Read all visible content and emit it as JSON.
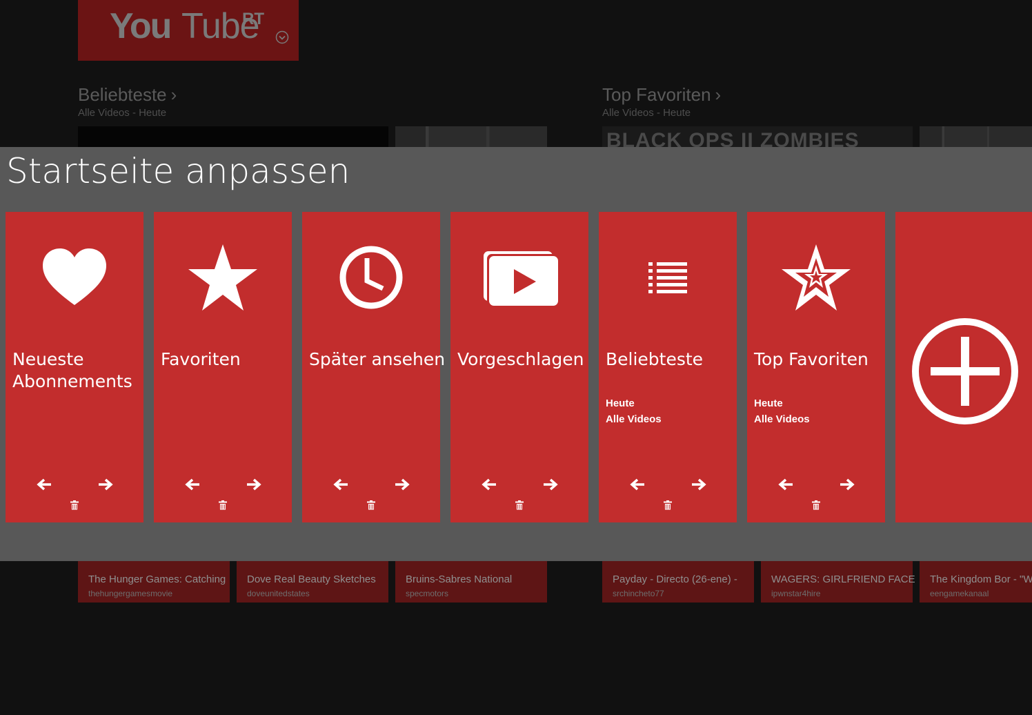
{
  "app": {
    "logo": {
      "you": "You",
      "tube": "Tube",
      "rt": "RT"
    }
  },
  "background": {
    "sections": [
      {
        "title": "Beliebteste",
        "subtitle": "Alle Videos - Heute"
      },
      {
        "title": "Top Favoriten",
        "subtitle": "Alle Videos - Heute"
      }
    ],
    "thumbnail_text": "BLACK OPS II ZOMBIES",
    "videos": [
      {
        "title": "The Hunger Games: Catching",
        "author": "thehungergamesmovie"
      },
      {
        "title": "Dove Real Beauty Sketches",
        "author": "doveunitedstates"
      },
      {
        "title": "Bruins-Sabres National",
        "author": "specmotors"
      },
      {
        "title": "Payday - Directo (26-ene) -",
        "author": "srchincheto77"
      },
      {
        "title": "WAGERS: GIRLFRIEND FACE",
        "author": "ipwnstar4hire"
      },
      {
        "title": "The Kingdom Bor - \"W",
        "author": "eengamekanaal"
      }
    ]
  },
  "overlay": {
    "title": "Startseite anpassen",
    "tiles": [
      {
        "label": "Neueste\nAbonnements",
        "icon": "heart-icon",
        "meta1": "",
        "meta2": ""
      },
      {
        "label": "Favoriten",
        "icon": "star-icon",
        "meta1": "",
        "meta2": ""
      },
      {
        "label": "Später ansehen",
        "icon": "clock-icon",
        "meta1": "",
        "meta2": ""
      },
      {
        "label": "Vorgeschlagen",
        "icon": "play-stack-icon",
        "meta1": "",
        "meta2": ""
      },
      {
        "label": "Beliebteste",
        "icon": "list-icon",
        "meta1": "Heute",
        "meta2": "Alle Videos"
      },
      {
        "label": "Top Favoriten",
        "icon": "star-outline-icon",
        "meta1": "Heute",
        "meta2": "Alle Videos"
      }
    ],
    "add_tile_icon": "plus-circle-icon"
  },
  "colors": {
    "tile": "#c22d2d",
    "overlay": "#585858",
    "background": "#111111"
  }
}
